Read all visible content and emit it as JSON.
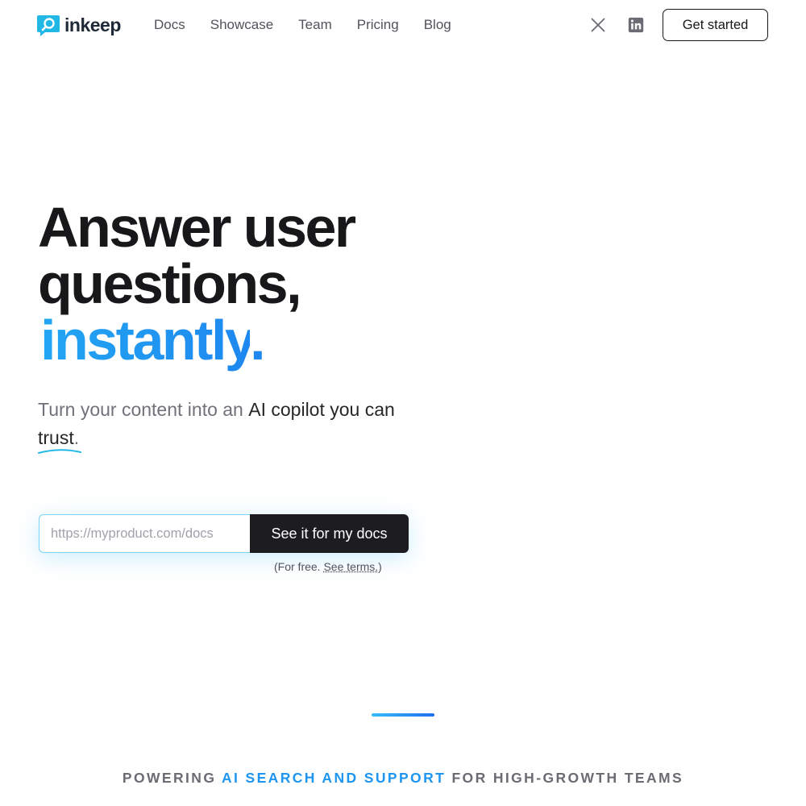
{
  "brand": {
    "name": "inkeep"
  },
  "nav": {
    "items": [
      {
        "label": "Docs"
      },
      {
        "label": "Showcase"
      },
      {
        "label": "Team"
      },
      {
        "label": "Pricing"
      },
      {
        "label": "Blog"
      }
    ],
    "social": [
      "x-icon",
      "linkedin-icon"
    ],
    "cta_label": "Get started"
  },
  "hero": {
    "title_line1": "Answer user",
    "title_line2": "questions,",
    "title_accent": "instantly",
    "title_dot": ".",
    "subtitle_plain": "Turn your content into an ",
    "subtitle_strong": "AI copilot you can ",
    "subtitle_trust": "trust",
    "subtitle_end": "."
  },
  "form": {
    "placeholder": "https://myproduct.com/docs",
    "value": "",
    "submit_label": "See it for my docs",
    "note_prefix": "(For free. ",
    "note_link": "See terms.",
    "note_suffix": ")"
  },
  "powering": {
    "part1": "POWERING ",
    "highlight": "AI SEARCH AND SUPPORT",
    "part2": " FOR HIGH-GROWTH TEAMS"
  },
  "colors": {
    "accent": "#1e95f0",
    "dark": "#18181b",
    "input_border": "#7dd3fc"
  }
}
